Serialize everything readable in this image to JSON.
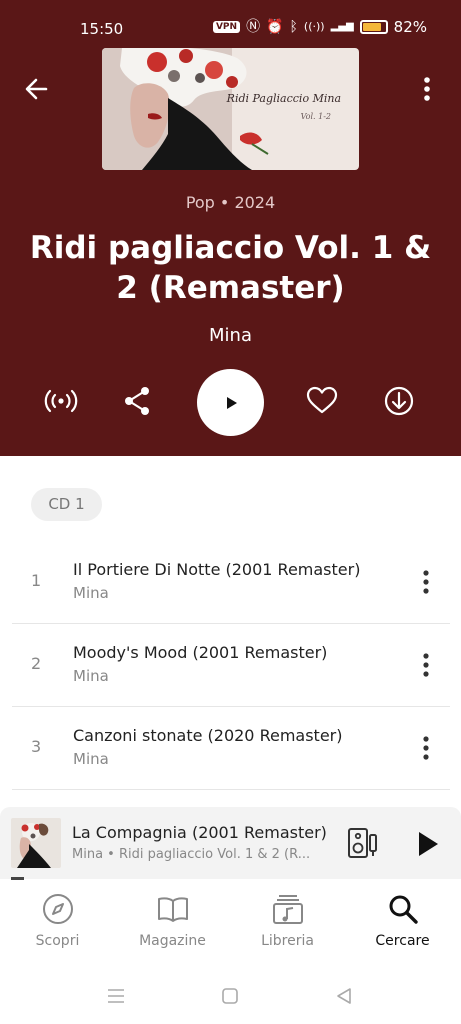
{
  "status_bar": {
    "time": "15:50",
    "vpn_label": "VPN",
    "nfc_glyph": "Ⓝ",
    "alarm_glyph": "⏰",
    "bluetooth_glyph": "ᛒ",
    "wifi_glyph": "((·))",
    "signal_glyph": "▂▄▆",
    "battery_percent": "82%",
    "battery_level": 0.82,
    "battery_color": "#f4b73a"
  },
  "header": {
    "back_icon": "arrow-left-icon",
    "more_icon": "more-vertical-icon"
  },
  "album": {
    "cover_title": "Ridi Pagliaccio  Mina",
    "cover_subtitle": "Vol. 1-2",
    "genre_year": "Pop • 2024",
    "title": "Ridi pagliaccio Vol. 1 & 2 (Remaster)",
    "artist": "Mina",
    "accent_color": "#5a1717"
  },
  "actions": {
    "radio_icon": "broadcast-icon",
    "share_icon": "share-icon",
    "play_icon": "play-icon",
    "favorite_icon": "heart-icon",
    "download_icon": "download-icon"
  },
  "disc_label": "CD 1",
  "tracks": [
    {
      "number": "1",
      "title": "Il Portiere Di Notte  (2001 Remaster)",
      "artist": "Mina"
    },
    {
      "number": "2",
      "title": "Moody's Mood  (2001 Remaster)",
      "artist": "Mina"
    },
    {
      "number": "3",
      "title": "Canzoni stonate  (2020 Remaster)",
      "artist": "Mina"
    }
  ],
  "now_playing": {
    "title": "La Compagnia  (2001 Remaster)",
    "subtitle": "Mina • Ridi pagliaccio Vol. 1 & 2  (R...",
    "device_icon": "speaker-device-icon",
    "play_icon": "play-icon",
    "progress": 0.03
  },
  "nav": {
    "items": [
      {
        "label": "Scopri",
        "icon": "compass-icon",
        "active": false
      },
      {
        "label": "Magazine",
        "icon": "book-open-icon",
        "active": false
      },
      {
        "label": "Libreria",
        "icon": "library-music-icon",
        "active": false
      },
      {
        "label": "Cercare",
        "icon": "search-icon",
        "active": true
      }
    ]
  },
  "system_nav": {
    "menu_icon": "menu-lines-icon",
    "home_icon": "square-home-icon",
    "back_icon": "triangle-back-icon"
  }
}
